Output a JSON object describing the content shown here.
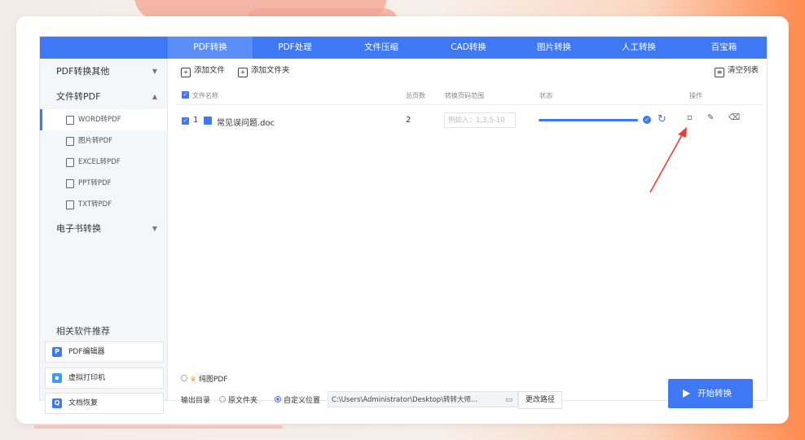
{
  "tabs": [
    "PDF转换",
    "PDF处理",
    "文件压缩",
    "CAD转换",
    "图片转换",
    "人工转换",
    "百宝箱"
  ],
  "sidebar": {
    "categories": [
      {
        "label": "PDF转换其他",
        "arrow": "▼"
      },
      {
        "label": "文件转PDF",
        "arrow": "▲"
      },
      {
        "label": "电子书转换",
        "arrow": "▼"
      }
    ],
    "sub_items": [
      "WORD转PDF",
      "图片转PDF",
      "EXCEL转PDF",
      "PPT转PDF",
      "TXT转PDF"
    ],
    "recommend_title": "相关软件推荐",
    "recommend": [
      {
        "label": "PDF编辑器",
        "icon": "P",
        "color": "#3f78f5"
      },
      {
        "label": "虚拟打印机",
        "icon": "▪",
        "color": "#3f9cf5"
      },
      {
        "label": "文档恢复",
        "icon": "Q",
        "color": "#3f78f5"
      }
    ]
  },
  "toolbar": {
    "add_file": "添加文件",
    "add_folder": "添加文件夹",
    "clear_list": "清空列表"
  },
  "table": {
    "headers": {
      "name": "文件名称",
      "pages": "总页数",
      "range": "转换页码范围",
      "status": "状态",
      "ops": "操作"
    },
    "row": {
      "index": "1",
      "filename": "常见误问题.doc",
      "pages": "2",
      "range_placeholder": "例如入：1,3,5-10"
    },
    "progress": 100
  },
  "bottom": {
    "pure_image": "纯图PDF",
    "output_label": "输出目录",
    "opt_original": "原文件夹",
    "opt_custom": "自定义位置",
    "path": "C:\\Users\\Administrator\\Desktop\\转转大师...",
    "change_path": "更改路径",
    "start": "开始转换"
  },
  "colors": {
    "accent": "#3f78f5",
    "annotation_arrow": "#f03c2e"
  }
}
